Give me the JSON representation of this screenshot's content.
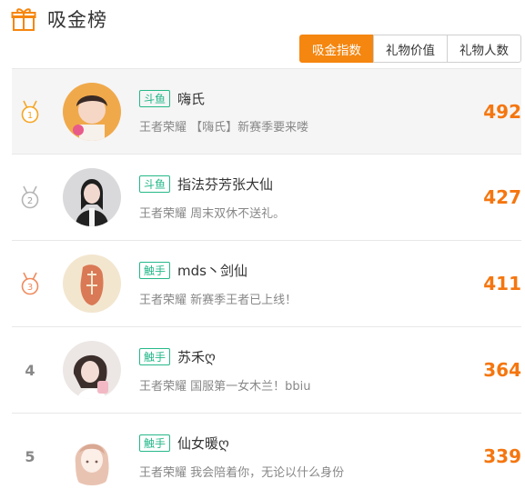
{
  "header": {
    "title": "吸金榜",
    "icon": "gift-icon"
  },
  "tabs": [
    {
      "label": "吸金指数",
      "active": true
    },
    {
      "label": "礼物价值",
      "active": false
    },
    {
      "label": "礼物人数",
      "active": false
    }
  ],
  "colors": {
    "accent": "#f5860f",
    "score": "#f5760f",
    "badge": "#25b88a"
  },
  "rows": [
    {
      "rank": "1",
      "medal": "gold",
      "platform": "斗鱼",
      "name": "嗨氏",
      "desc": "王者荣耀 【嗨氏】新赛季要来喽",
      "score": "492"
    },
    {
      "rank": "2",
      "medal": "silver",
      "platform": "斗鱼",
      "name": "指法芬芳张大仙",
      "desc": "王者荣耀 周末双休不送礼。",
      "score": "427"
    },
    {
      "rank": "3",
      "medal": "bronze",
      "platform": "触手",
      "name": "mds丶剑仙",
      "desc": "王者荣耀 新赛季王者已上线！",
      "score": "411"
    },
    {
      "rank": "4",
      "medal": "",
      "platform": "触手",
      "name": "苏禾ღ",
      "desc": "王者荣耀 国服第一女木兰！bbiu",
      "score": "364"
    },
    {
      "rank": "5",
      "medal": "",
      "platform": "触手",
      "name": "仙女暖ღ",
      "desc": "王者荣耀 我会陪着你，无论以什么身份",
      "score": "339"
    }
  ]
}
